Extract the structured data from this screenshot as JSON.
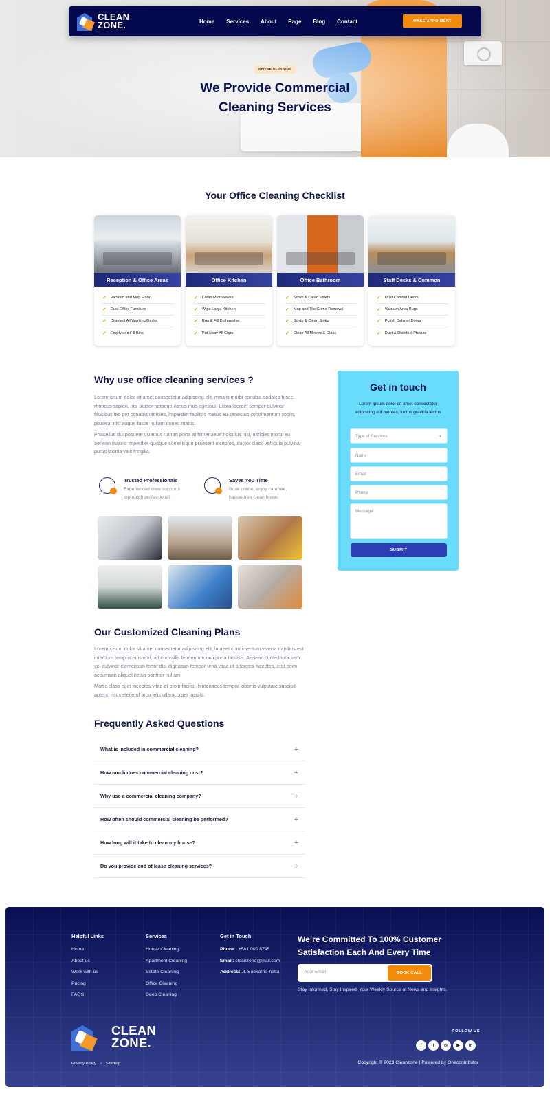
{
  "nav": {
    "logo_line1": "CLEAN",
    "logo_line2": "ZONE.",
    "links": [
      "Home",
      "Services",
      "About",
      "Page",
      "Blog",
      "Contact"
    ],
    "cta": "MAKE APPOIMENT"
  },
  "hero": {
    "badge": "OFFICE CLEANING",
    "title_line1": "We Provide Commercial",
    "title_line2": "Cleaning Services"
  },
  "checklist": {
    "title": "Your Office Cleaning Checklist",
    "cards": [
      {
        "title": "Reception & Office Areas",
        "items": [
          "Vacuum and Mop Floor",
          "Dust Office Furniture",
          "Disinfect All Working Desks",
          "Empty and Fill Bins"
        ]
      },
      {
        "title": "Office Kitchen",
        "items": [
          "Clean Microwaves",
          "Wipe Large Kitchen",
          "Run & Fill Dishwasher",
          "Put Away All Cups"
        ]
      },
      {
        "title": "Office Bathroom",
        "items": [
          "Scrub & Clean Toilets",
          "Mop and Tile Grime Removal",
          "Scrub & Clean Sinks",
          "Clean All Mirrors & Glass"
        ]
      },
      {
        "title": "Staff Desks & Common",
        "items": [
          "Dust Cabinet Doors",
          "Vacuum Area Rugs",
          "Polish Cabinet Doors",
          "Dust & Disinfect Phones"
        ]
      }
    ]
  },
  "why": {
    "title": "Why use office cleaning services ?",
    "p1": "Lorem ipsum dolor sit amet consectetur adipiscing elit, mauris morbi conubia sodales fusce rhoncus sapien, nisi auctor natoque varius mus egestas. Litora laoreet semper pulvinar faucibus leo per conubia ultricies, imperdiet facilisis metus eu senectus condimentum sociis, placerat nisi augue fusce nullam donec mattis.",
    "p2": "Phasellus dui posuere vivamus rutrum porta at himenaeos ridiculus nisi, ultricies morbi eu aenean mauris imperdiet quisque scelerisque praesent inceptos, auctor class vehicula pulvinar purus lacinia velit fringilla.",
    "features": [
      {
        "title": "Trusted Professionals",
        "line1": "Experienced crew supports",
        "line2": "top-notch professional.",
        "icon": "team-icon"
      },
      {
        "title": "Saves You Time",
        "line1": "Book online, enjoy carefree,",
        "line2": "hassle-free clean home.",
        "icon": "gear-clock-icon"
      }
    ]
  },
  "contact": {
    "title": "Get in touch",
    "subtitle": "Lorem ipsum dolor sit amet consectetur adipiscing elit montes, luctus gravida lectus",
    "service_placeholder": "Type of Services",
    "name_placeholder": "Name",
    "email_placeholder": "Email",
    "phone_placeholder": "Phone",
    "message_placeholder": "Message",
    "submit": "SUBMIT"
  },
  "plans": {
    "title": "Our Customized Cleaning Plans",
    "p1": "Lorem ipsum dolor sit amet consectetur adipiscing elit, laoreet condimentum viverra dapibus est interdum tempus euismod, ad convallis fermentum orci porta facilisis. Aenean curae litora sem vel pulvinar elementum tortor dis, dignissim tempor urna vitae ut pharetra inceptos, erat enim accumsan aliquet netus porttitor nullam.",
    "p2": "Mattis class eget inceptos vitae et proin facilisi, himenaeos tempor lobortis vulputate suscipit aptent, risus eleifend arcu felis ullamcorper iaculis."
  },
  "faq": {
    "title": "Frequently Asked Questions",
    "items": [
      "What is included in commercial cleaning?",
      "How much does commercial cleaning cost?",
      "Why use a commercial cleaning company?",
      "How often should commercial cleaning be performed?",
      "How long will it take to clean my house?",
      "Do you provide end of lease cleaning services?"
    ]
  },
  "footer": {
    "helpful_title": "Helpful Links",
    "helpful": [
      "Home",
      "About us",
      "Work with us",
      "Pricing",
      "FAQS"
    ],
    "services_title": "Services",
    "services": [
      "House Cleaning",
      "Apartment Cleaning",
      "Estate Cleaning",
      "Office Cleaning",
      "Deep Cleaning"
    ],
    "touch_title": "Get in Touch",
    "phone_label": "Phone :",
    "phone": "+581 000 8745",
    "email_label": "Email:",
    "email": "cleanzone@mail.com",
    "address_label": "Address:",
    "address": "Jl. Soekarno-hatta",
    "headline_line1": "We’re Committed To 100% Customer",
    "headline_line2": "Satisfaction Each And Every Time",
    "email_placeholder": "Your Email",
    "book_call": "BOOK CALL",
    "note": "Stay Informed, Stay Inspired: Your Weekly Source of News and Insights.",
    "follow": "FOLLOW US",
    "privacy": "Privacy Policy",
    "sitemap": "Sitemap",
    "separator": "›",
    "copyright": "Copyright © 2023 Cleanzone | Powered by Onecontributor"
  },
  "colors": {
    "navy": "#050a4e",
    "accent": "#f28a0c",
    "form_bg": "#69dcfb",
    "submit": "#2c3eb3"
  }
}
